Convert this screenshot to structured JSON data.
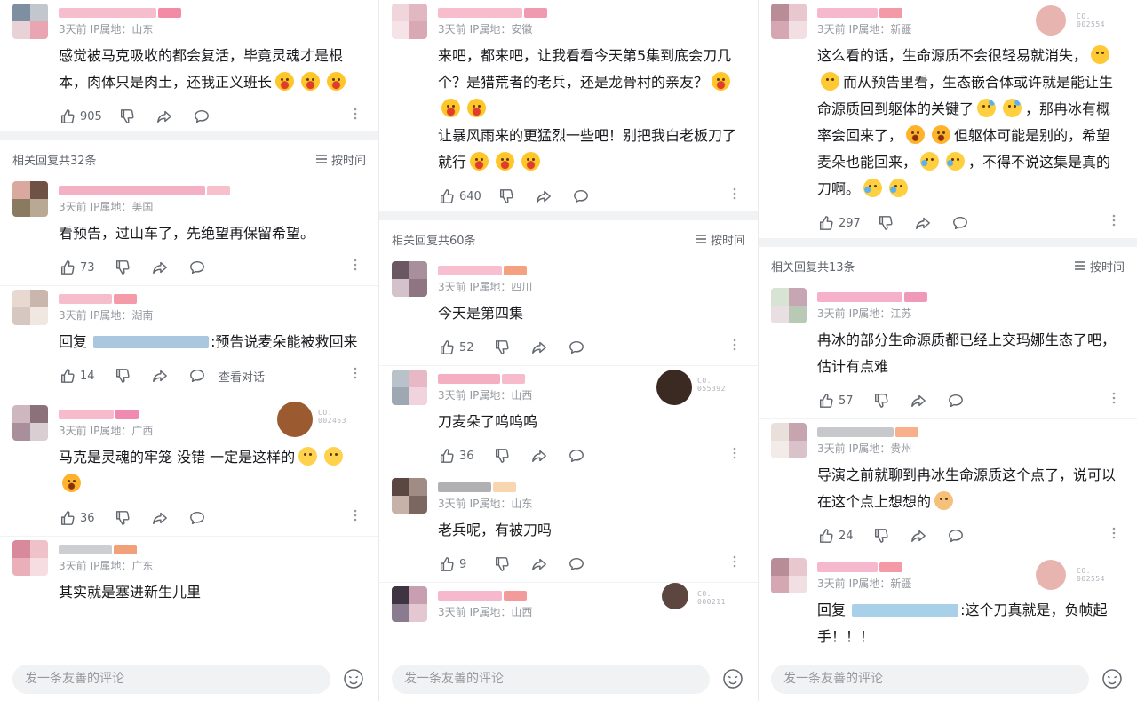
{
  "ui": {
    "like_icon": "thumb-up-icon",
    "dislike_icon": "thumb-down-icon",
    "share_icon": "share-icon",
    "reply_icon": "comment-icon",
    "more_icon": "more-dots-icon",
    "sort_icon": "sort-lines-icon",
    "accent": "#fb7299"
  },
  "panels": [
    {
      "main": {
        "time": "3天前",
        "ip": "IP属地：山东",
        "text": "感觉被马克吸收的都会复活，毕竟灵魂才是根本，肉体只是肉土，还我正义班长",
        "emojis": [
          "cry",
          "cry",
          "cry"
        ],
        "likes": "905",
        "avatar": [
          "#7d8fa0",
          "#c2c7ce",
          "#e8d2d8",
          "#eaa5b3"
        ],
        "name": [
          "#f5b6c8",
          "#f38ba5"
        ]
      },
      "reply_header": {
        "count": "相关回复共32条",
        "sort": "按时间"
      },
      "replies": [
        {
          "time": "3天前",
          "ip": "IP属地：美国",
          "text": "看预告，过山车了，先绝望再保留希望。",
          "likes": "73",
          "avatar": [
            "#d9a9a0",
            "#6f5246",
            "#8a7b60",
            "#b9a894"
          ],
          "name": [
            "#f3a8c0",
            "#f6c0cc"
          ]
        },
        {
          "time": "3天前",
          "ip": "IP属地：湖南",
          "reply_prefix": "回复",
          "reply_suffix": ":预告说麦朵能被救回来",
          "likes": "14",
          "conversation": "查看对话",
          "avatar": [
            "#e7d9cf",
            "#c9b7ad",
            "#d6c8c0",
            "#f0e7e1"
          ],
          "name": [
            "#f5b6c8",
            "#f59aa8"
          ],
          "mention": "#a9c8e0"
        },
        {
          "time": "3天前",
          "ip": "IP属地：广西",
          "text": "马克是灵魂的牢笼 没错 一定是这样的",
          "emojis": [
            "smile",
            "smile",
            "shock"
          ],
          "likes": "36",
          "avatar": [
            "#cfb7c0",
            "#8b7179",
            "#a98f99",
            "#d9cfd3"
          ],
          "name": [
            "#f7b3c8",
            "#f08ab0"
          ],
          "fan": {
            "label1": "CO.",
            "label2": "002463",
            "color": "#9c5a30"
          }
        },
        {
          "time": "3天前",
          "ip": "IP属地：广东",
          "text": "其实就是塞进新生儿里",
          "likes": "",
          "avatar": [
            "#d88a9a",
            "#efc1c9",
            "#e9b0ba",
            "#f5dde1"
          ],
          "name": [
            "#c7c9cc",
            "#f2a07a"
          ]
        }
      ],
      "input_placeholder": "发一条友善的评论"
    },
    {
      "main": {
        "time": "3天前",
        "ip": "IP属地：安徽",
        "text": "来吧，都来吧，让我看看今天第5集到底会刀几个？是猎荒者的老兵，还是龙骨村的亲友？",
        "emojis": [
          "cry",
          "cry",
          "cry"
        ],
        "text2": "让暴风雨来的更猛烈一些吧！别把我白老板刀了就行",
        "emojis2": [
          "cry",
          "cry",
          "cry"
        ],
        "likes": "640",
        "avatar": [
          "#f0d5dc",
          "#e1b7c1",
          "#f6e3e8",
          "#d8a9b5"
        ],
        "name": [
          "#f7b6c7",
          "#f09ab0"
        ]
      },
      "reply_header": {
        "count": "相关回复共60条",
        "sort": "按时间"
      },
      "replies": [
        {
          "time": "3天前",
          "ip": "IP属地：四川",
          "text": "今天是第四集",
          "likes": "52",
          "avatar": [
            "#6b5761",
            "#a98f9c",
            "#d4c2cb",
            "#8f7582"
          ],
          "name": [
            "#f6b8cb",
            "#f5a080"
          ]
        },
        {
          "time": "3天前",
          "ip": "IP属地：山西",
          "text": "刀麦朵了呜呜呜",
          "likes": "36",
          "avatar": [
            "#b9c2cb",
            "#e7b8c6",
            "#9ea8b2",
            "#f1d3dd"
          ],
          "name": [
            "#f3a6bd",
            "#f6bccc"
          ],
          "fan": {
            "label1": "CO.",
            "label2": "055392",
            "color": "#3b2a22"
          }
        },
        {
          "time": "3天前",
          "ip": "IP属地：山东",
          "text": "老兵呢，有被刀吗",
          "likes": "9",
          "avatar": [
            "#5b4742",
            "#a08c84",
            "#c6b2a8",
            "#7c6660"
          ],
          "name": [
            "#a8a9ac",
            "#f7d6b0"
          ]
        },
        {
          "time": "3天前",
          "ip": "IP属地：山西",
          "text": "",
          "likes": "",
          "avatar": [
            "#3e3442",
            "#c89fb0",
            "#8a7b8f",
            "#e3c8d2"
          ],
          "name": [
            "#f5b0c8",
            "#f39b9b"
          ],
          "fan": {
            "label1": "CO.",
            "label2": "000211",
            "color": "#5d4640"
          }
        }
      ],
      "input_placeholder": "发一条友善的评论"
    },
    {
      "main": {
        "time": "3天前",
        "ip": "IP属地：新疆",
        "text": "这么看的话，生命源质不会很轻易就消失，",
        "emojis": [],
        "text_b": "而从预告里看，生态嵌合体或许就是能让生命源质回到躯体的关键了",
        "text_c": "，那冉冰有概率会回来了，",
        "text_d": "但躯体可能是别的，希望麦朵也能回来，",
        "text_e": "，不得不说这集是真的刀啊。",
        "likes": "297",
        "avatar": [
          "#b88d97",
          "#e8c7cf",
          "#d5a7b3",
          "#f1dfe4"
        ],
        "name": [
          "#f5b0c6",
          "#f39aa6"
        ],
        "fan": {
          "label1": "CO.",
          "label2": "002554",
          "color": "#e8b4b0"
        }
      },
      "reply_header": {
        "count": "相关回复共13条",
        "sort": "按时间"
      },
      "replies": [
        {
          "time": "3天前",
          "ip": "IP属地：江苏",
          "text": "冉冰的部分生命源质都已经上交玛娜生态了吧，估计有点难",
          "likes": "57",
          "avatar": [
            "#d7e3d3",
            "#c7a6b3",
            "#e9dfe3",
            "#b8c9b6"
          ],
          "name": [
            "#f4a8c4",
            "#ef98b8"
          ]
        },
        {
          "time": "3天前",
          "ip": "IP属地：贵州",
          "text": "导演之前就聊到冉冰生命源质这个点了，说可以在这个点上想想的",
          "emojis": [
            "doge"
          ],
          "likes": "24",
          "avatar": [
            "#e9dfdb",
            "#c6a5ae",
            "#f3ebe8",
            "#d9c2c9"
          ],
          "name": [
            "#c0c2c6",
            "#f7b08a"
          ]
        },
        {
          "time": "3天前",
          "ip": "IP属地：新疆",
          "reply_prefix": "回复",
          "reply_suffix": ":这个刀真就是，负帧起手！！！",
          "likes": "",
          "avatar": [
            "#b88d97",
            "#e8c7cf",
            "#d5a7b3",
            "#f1dfe4"
          ],
          "name": [
            "#f5b0c6",
            "#f39aa6"
          ],
          "mention": "#a8d0e8",
          "fan": {
            "label1": "CO.",
            "label2": "002554",
            "color": "#e8b4b0"
          }
        }
      ],
      "input_placeholder": "发一条友善的评论"
    }
  ]
}
